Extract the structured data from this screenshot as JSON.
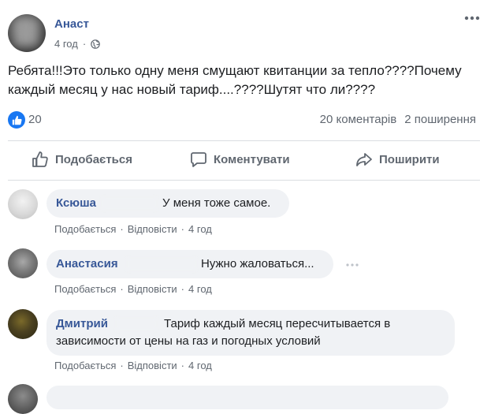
{
  "post": {
    "author": "Анаст",
    "time": "4 год",
    "audience_icon": "globe-icon",
    "more_icon": "dots-icon",
    "text": "Ребята!!!Это только одну меня смущают квитанции за тепло????Почему каждый месяц у нас новый тариф....????Шутят что ли????",
    "reactions_count": "20",
    "comments_count": "20 коментарів",
    "shares_count": "2 поширення"
  },
  "actions": {
    "like": "Подобається",
    "comment": "Коментувати",
    "share": "Поширити"
  },
  "comments": [
    {
      "name": "Ксюша",
      "text": "У меня тоже самое.",
      "like": "Подобається",
      "reply": "Відповісти",
      "time": "4 год"
    },
    {
      "name": "Анастасия",
      "text": "Нужно жаловаться...",
      "like": "Подобається",
      "reply": "Відповісти",
      "time": "4 год"
    },
    {
      "name": "Дмитрий",
      "text": "Тариф каждый месяц пересчитывается в",
      "text_line2": "зависимости от цены на газ и погодных условий",
      "like": "Подобається",
      "reply": "Відповісти",
      "time": "4 год"
    }
  ],
  "separator": "·",
  "colors": {
    "link": "#385898",
    "meta": "#606770",
    "bubble": "#f0f2f5",
    "like_blue": "#1877f2"
  }
}
